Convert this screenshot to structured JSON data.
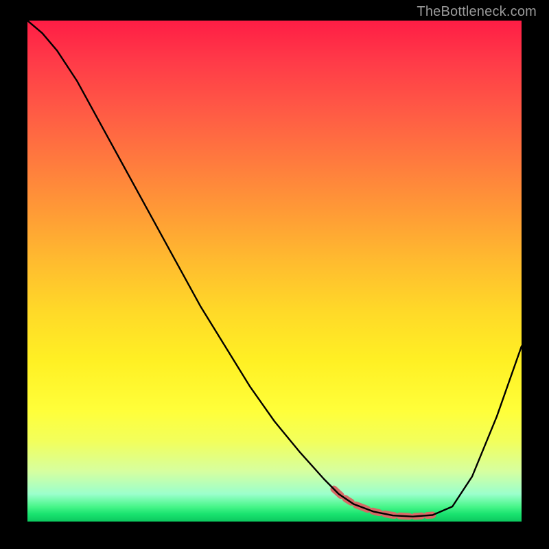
{
  "watermark": "TheBottleneck.com",
  "colors": {
    "background": "#000000",
    "curve": "#000000",
    "highlight": "#d66a66",
    "gradient_top": "#ff1d45",
    "gradient_bottom": "#0cc85f",
    "watermark_text": "#9a9a9a"
  },
  "chart_data": {
    "type": "line",
    "title": "",
    "xlabel": "",
    "ylabel": "",
    "xlim": [
      0,
      100
    ],
    "ylim": [
      0,
      100
    ],
    "x": [
      0,
      3,
      6,
      10,
      15,
      20,
      25,
      30,
      35,
      40,
      45,
      50,
      55,
      60,
      63,
      66,
      70,
      74,
      78,
      82,
      86,
      90,
      95,
      100
    ],
    "values": [
      100,
      97.5,
      94,
      88,
      79,
      70,
      61,
      52,
      43,
      35,
      27,
      20,
      14,
      8.5,
      5.5,
      3.5,
      2,
      1.2,
      1,
      1.3,
      3,
      9,
      21,
      35
    ],
    "highlight_x_range": [
      62,
      82
    ],
    "legend": null,
    "annotations": []
  }
}
